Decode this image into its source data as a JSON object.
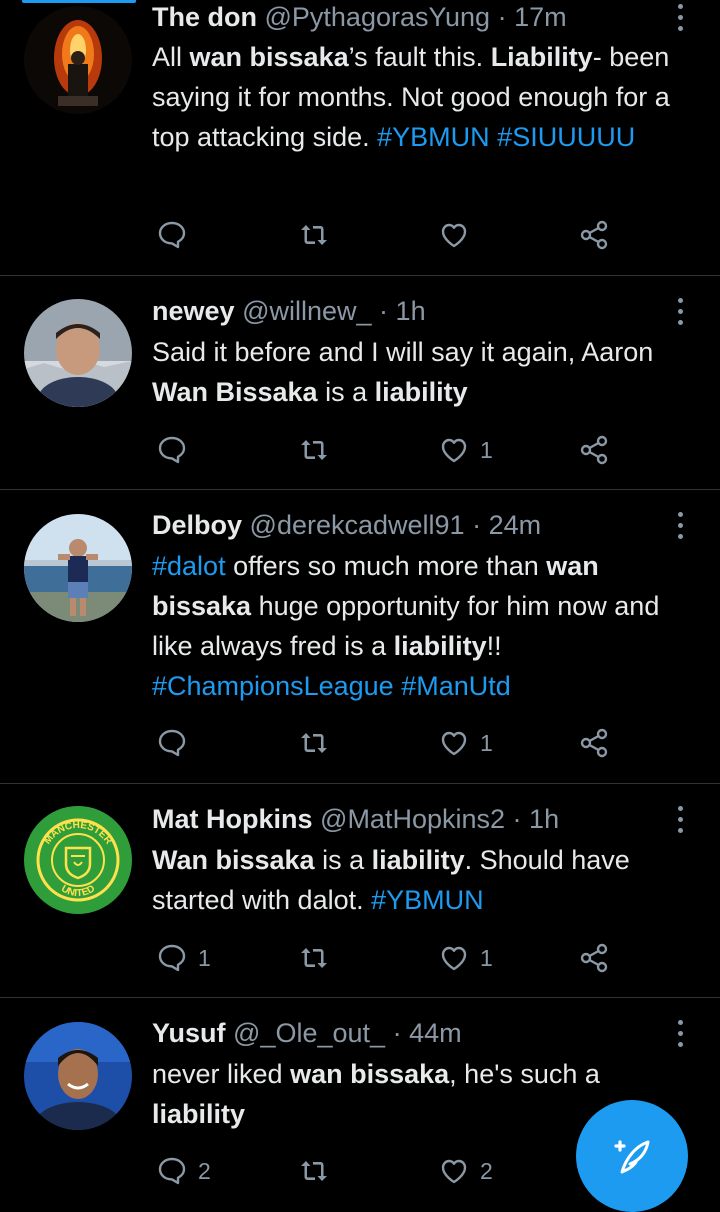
{
  "colors": {
    "background": "#000000",
    "text": "#e7e9ea",
    "muted": "#8b98a5",
    "accent": "#1d9bf0",
    "divider": "#2f3336"
  },
  "tweets": [
    {
      "name": "The don",
      "handle": "@PythagorasYung",
      "dot": "·",
      "time": "17m",
      "avatar_icon": "fire-figure-avatar",
      "body": [
        {
          "t": "All ",
          "s": "n"
        },
        {
          "t": "wan bissaka",
          "s": "b"
        },
        {
          "t": "’s fault this. ",
          "s": "n"
        },
        {
          "t": "Liability",
          "s": "b"
        },
        {
          "t": "- been saying it for months. Not good enough for a top attacking side. ",
          "s": "n"
        },
        {
          "t": "#YBMUN",
          "s": "h"
        },
        {
          "t": " ",
          "s": "n"
        },
        {
          "t": "#SIUUUUU",
          "s": "h"
        }
      ],
      "replies": "",
      "retweets": "",
      "likes": ""
    },
    {
      "name": "newey",
      "handle": "@willnew_",
      "dot": "·",
      "time": "1h",
      "avatar_icon": "person-photo-avatar",
      "body": [
        {
          "t": "Said it before and I will say it again, Aaron ",
          "s": "n"
        },
        {
          "t": "Wan Bissaka",
          "s": "b"
        },
        {
          "t": " is a ",
          "s": "n"
        },
        {
          "t": "liability",
          "s": "b"
        }
      ],
      "replies": "",
      "retweets": "",
      "likes": "1"
    },
    {
      "name": "Delboy",
      "handle": "@derekcadwell91",
      "dot": "·",
      "time": "24m",
      "avatar_icon": "person-seaside-avatar",
      "body": [
        {
          "t": "#dalot",
          "s": "h"
        },
        {
          "t": " offers so much more than ",
          "s": "n"
        },
        {
          "t": "wan bissaka",
          "s": "b"
        },
        {
          "t": " huge opportunity  for him now and like always fred  is a ",
          "s": "n"
        },
        {
          "t": "liability",
          "s": "b"
        },
        {
          "t": "!! ",
          "s": "n"
        },
        {
          "t": "#ChampionsLeague",
          "s": "h"
        },
        {
          "t": " ",
          "s": "n"
        },
        {
          "t": "#ManUtd",
          "s": "h"
        }
      ],
      "replies": "",
      "retweets": "",
      "likes": "1"
    },
    {
      "name": "Mat Hopkins",
      "handle": "@MatHopkins2",
      "dot": "·",
      "time": "1h",
      "avatar_icon": "manchester-united-badge-avatar",
      "badge_text": {
        "top": "MANCHESTER",
        "bottom": "UNITED"
      },
      "body": [
        {
          "t": "Wan bissaka",
          "s": "b"
        },
        {
          "t": " is a ",
          "s": "n"
        },
        {
          "t": "liability",
          "s": "b"
        },
        {
          "t": ". Should have started with dalot. ",
          "s": "n"
        },
        {
          "t": "#YBMUN",
          "s": "h"
        }
      ],
      "replies": "1",
      "retweets": "",
      "likes": "1"
    },
    {
      "name": "Yusuf",
      "handle": "@_Ole_out_",
      "dot": "·",
      "time": "44m",
      "avatar_icon": "smiling-player-avatar",
      "body": [
        {
          "t": "never liked ",
          "s": "n"
        },
        {
          "t": "wan bissaka",
          "s": "b"
        },
        {
          "t": ", he's such a ",
          "s": "n"
        },
        {
          "t": "liability",
          "s": "b"
        }
      ],
      "replies": "2",
      "retweets": "",
      "likes": "2"
    }
  ],
  "fab": {
    "icon": "compose-tweet-icon"
  }
}
